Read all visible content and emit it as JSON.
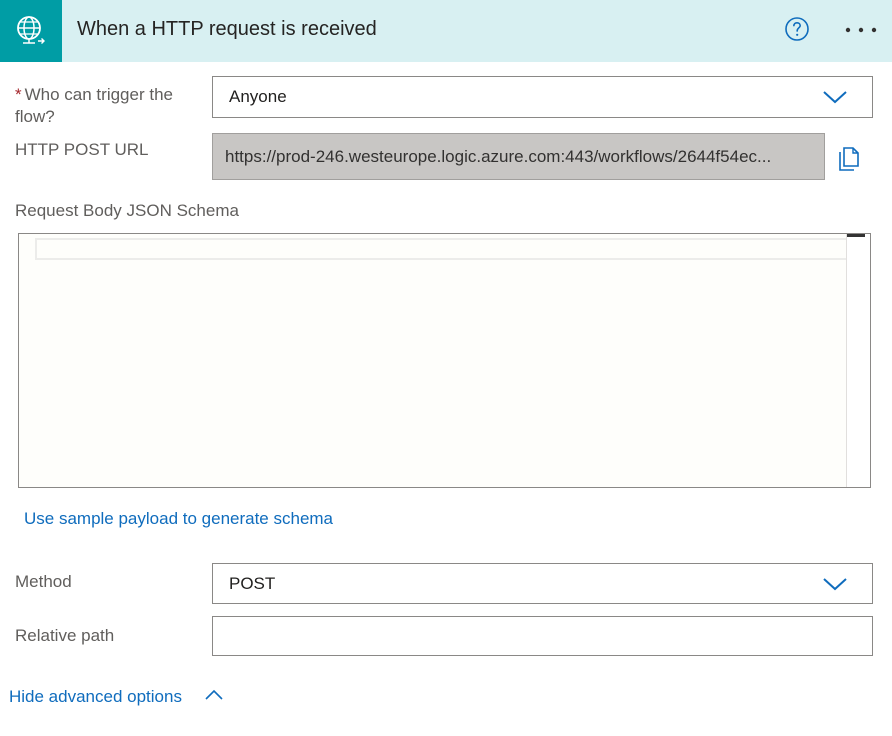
{
  "header": {
    "title": "When a HTTP request is received",
    "icon": "globe-request-icon",
    "help_icon": "help-circle-icon",
    "more_icon": "more-ellipsis-icon",
    "background": "#d8f0f2",
    "icon_background": "#009da5"
  },
  "fields": {
    "who_can_trigger": {
      "required_mark": "*",
      "label_line1": "Who can trigger the",
      "label_line2": "flow?",
      "value": "Anyone"
    },
    "http_post_url": {
      "label": "HTTP POST URL",
      "value": "https://prod-246.westeurope.logic.azure.com:443/workflows/2644f54ec..."
    },
    "request_body_schema": {
      "label": "Request Body JSON Schema",
      "value": ""
    },
    "method": {
      "label": "Method",
      "value": "POST"
    },
    "relative_path": {
      "label": "Relative path",
      "value": ""
    }
  },
  "links": {
    "sample_payload": "Use sample payload to generate schema",
    "hide_advanced": "Hide advanced options"
  },
  "colors": {
    "link": "#0f6cbd",
    "required": "#a4262c",
    "url_field_bg": "#c8c6c4"
  }
}
